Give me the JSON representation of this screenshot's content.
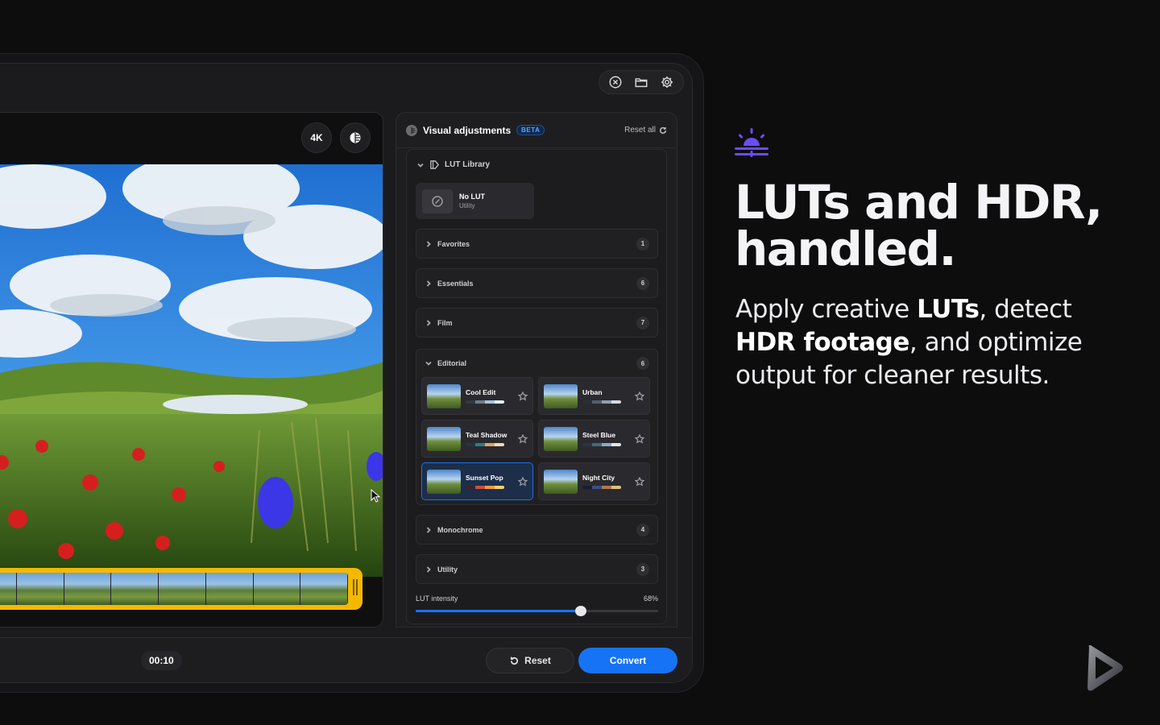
{
  "window": {
    "controls": [
      "close-circle-icon",
      "folder-icon",
      "gear-icon"
    ]
  },
  "preview": {
    "badge_4k": "4K",
    "badge_hdr_icon": "hdr-icon"
  },
  "bottom_bar": {
    "time": "00:10",
    "reset_label": "Reset",
    "convert_label": "Convert",
    "accent": "#1673f5"
  },
  "panel": {
    "title": "Visual adjustments",
    "badge": "BETA",
    "reset_all": "Reset all",
    "lut_library_label": "LUT Library",
    "no_lut": {
      "name": "No LUT",
      "category": "Utility"
    },
    "categories": [
      {
        "label": "Favorites",
        "count": "1"
      },
      {
        "label": "Essentials",
        "count": "6"
      },
      {
        "label": "Film",
        "count": "7"
      }
    ],
    "editorial": {
      "label": "Editorial",
      "count": "6",
      "luts": [
        {
          "name": "Cool Edit",
          "selected": false,
          "swatches": [
            "#2f3a48",
            "#6d7d8f",
            "#a9c4de",
            "#e6edf3"
          ]
        },
        {
          "name": "Urban",
          "selected": false,
          "swatches": [
            "#2a2f35",
            "#50606e",
            "#8ca0b0",
            "#d4dbe0"
          ]
        },
        {
          "name": "Teal Shadow",
          "selected": false,
          "swatches": [
            "#1b3a40",
            "#2f7d7e",
            "#e0a46a",
            "#f3d9b5"
          ]
        },
        {
          "name": "Steel Blue",
          "selected": false,
          "swatches": [
            "#263546",
            "#476783",
            "#8aa9c6",
            "#dfe7ee"
          ]
        },
        {
          "name": "Sunset Pop",
          "selected": true,
          "swatches": [
            "#3a2330",
            "#c9503f",
            "#f29b3c",
            "#f5d36b"
          ]
        },
        {
          "name": "Night City",
          "selected": false,
          "swatches": [
            "#1a1d2e",
            "#3b4e86",
            "#b07a4a",
            "#e4c07d"
          ]
        }
      ]
    },
    "more_categories": [
      {
        "label": "Monochrome",
        "count": "4"
      },
      {
        "label": "Utility",
        "count": "3"
      }
    ],
    "intensity": {
      "label": "LUT intensity",
      "value_text": "68%",
      "value": 0.68
    }
  },
  "marketing": {
    "headline_line1": "LUTs and HDR,",
    "headline_line2": "handled.",
    "sub_p1": "Apply creative ",
    "sub_b1": "LUTs",
    "sub_p2": ", detect ",
    "sub_b2": "HDR footage",
    "sub_p3": ", and optimize output for cleaner results.",
    "icon": "sunrise-icon",
    "icon_color": "#6c4cf5"
  }
}
